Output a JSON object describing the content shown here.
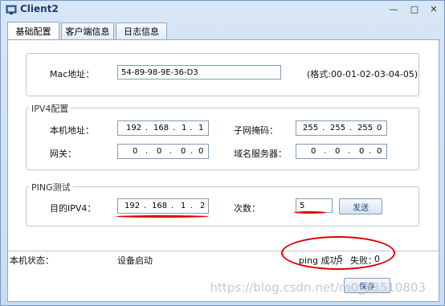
{
  "window": {
    "title": "Client2"
  },
  "tabs": [
    {
      "label": "基础配置"
    },
    {
      "label": "客户端信息"
    },
    {
      "label": "日志信息"
    }
  ],
  "mac": {
    "label": "Mac地址：",
    "value": "54-89-98-9E-36-D3",
    "hint": "(格式:00-01-02-03-04-05)"
  },
  "ipv4": {
    "group_label": "IPV4配置",
    "local_ip_label": "本机地址：",
    "local_ip": [
      "192",
      "168",
      "1",
      "1"
    ],
    "mask_label": "子网掩码：",
    "mask": [
      "255",
      "255",
      "255",
      "0"
    ],
    "gateway_label": "网关：",
    "gateway": [
      "0",
      "0",
      "0",
      "0"
    ],
    "dns_label": "域名服务器：",
    "dns": [
      "0",
      "0",
      "0",
      "0"
    ]
  },
  "ping": {
    "group_label": "PING测试",
    "dest_label": "目的IPV4：",
    "dest": [
      "192",
      "168",
      "1",
      "2"
    ],
    "count_label": "次数：",
    "count": "5",
    "send_label": "发送"
  },
  "status": {
    "label": "本机状态：",
    "value": "设备启动",
    "ping_success_label": "ping 成功：",
    "ping_success": "5",
    "fail_label": "失败：",
    "fail": "0"
  },
  "save_label": "保存",
  "watermark": "https://blog.csdn.net/m0_53510803"
}
